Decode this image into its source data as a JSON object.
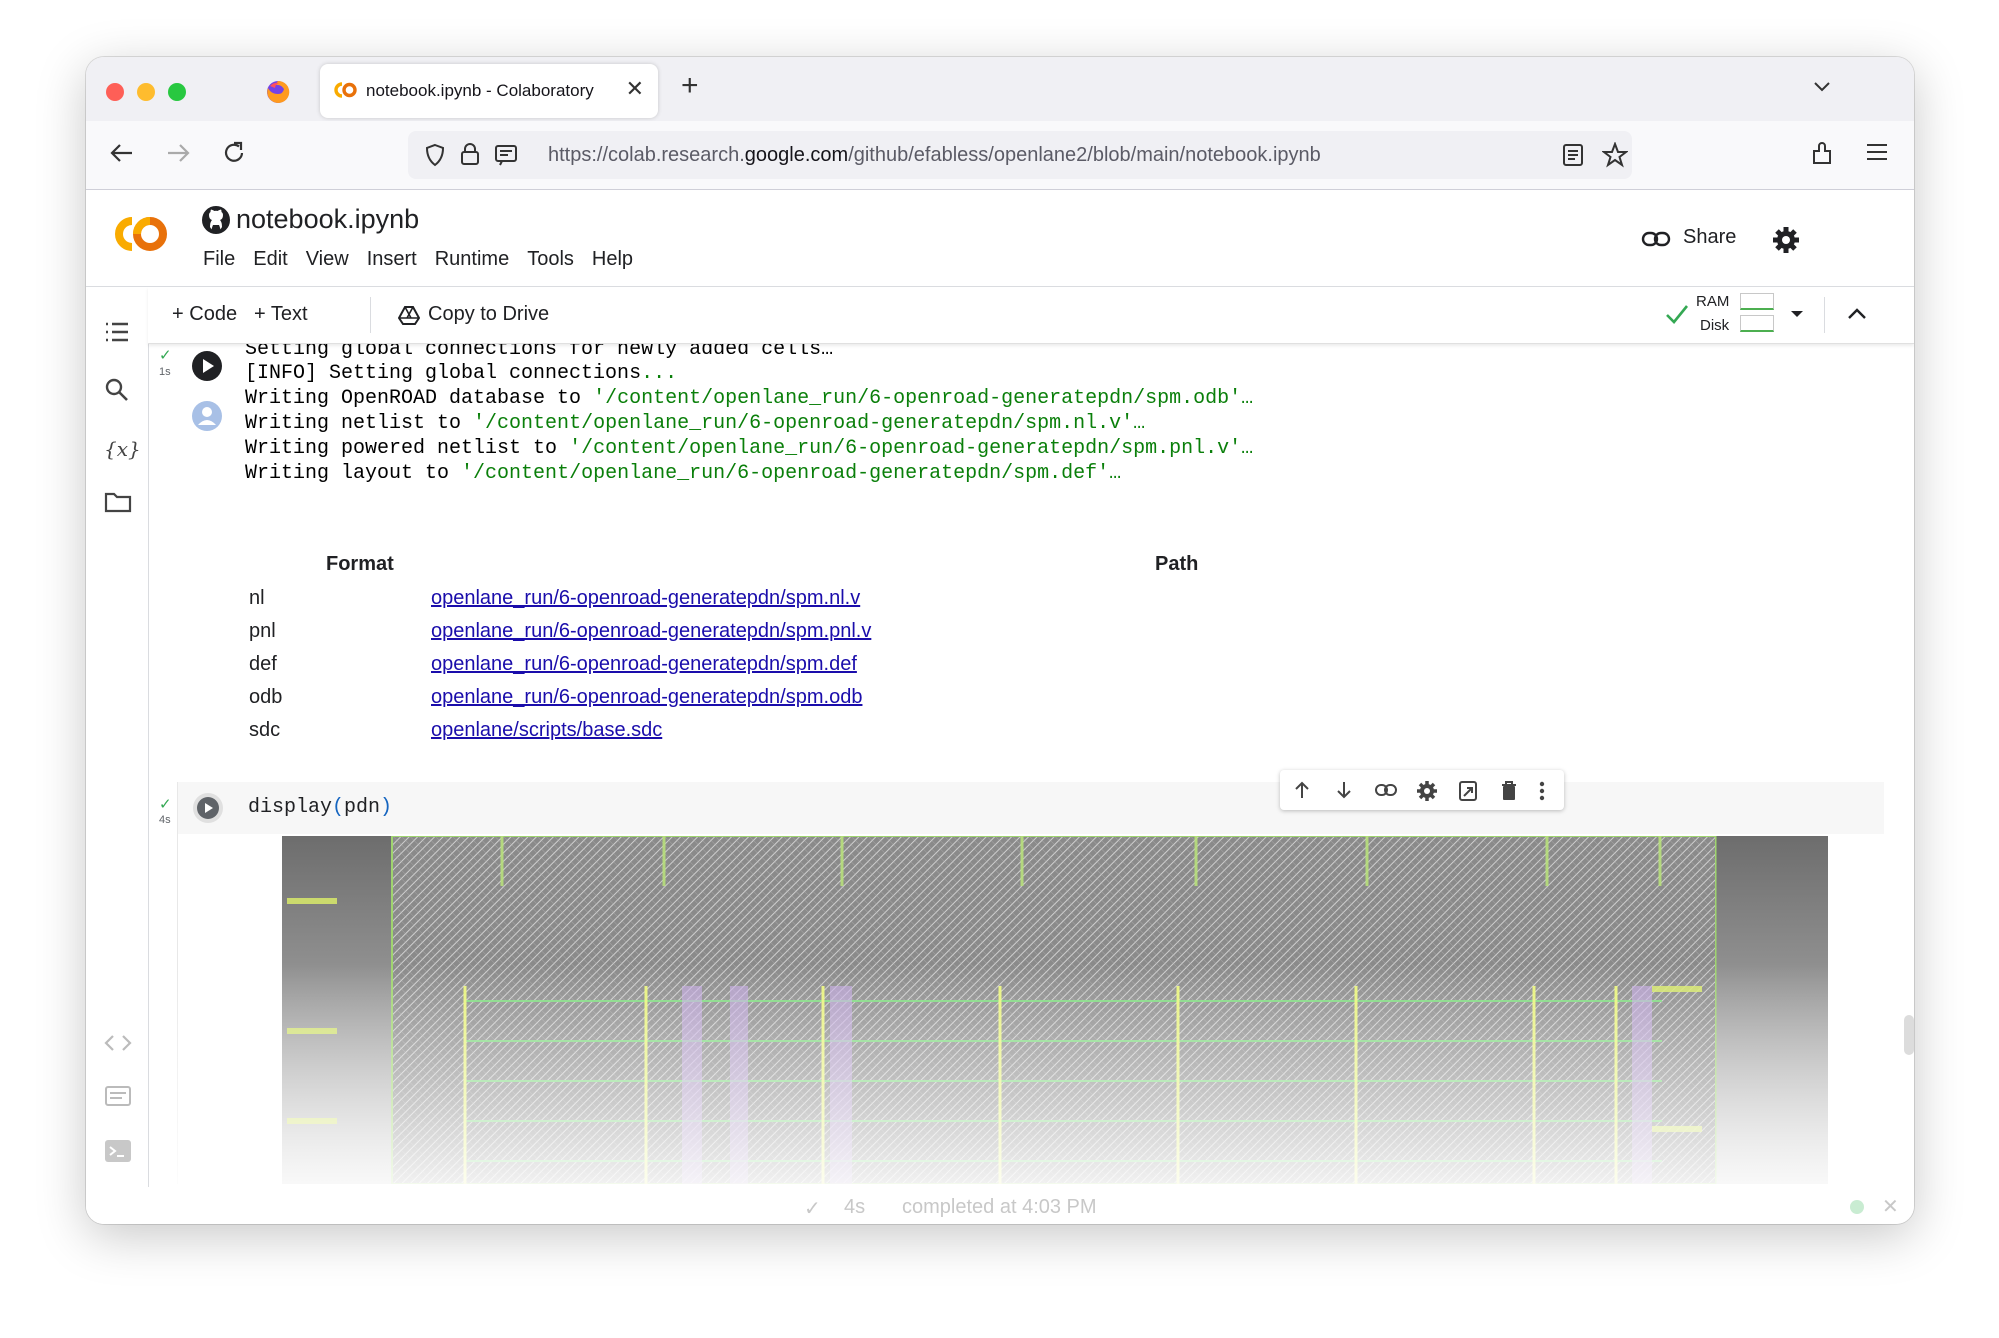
{
  "browser": {
    "tab_title": "notebook.ipynb - Colaboratory",
    "url_prefix": "https://colab.research.",
    "url_domain": "google.com",
    "url_path": "/github/efabless/openlane2/blob/main/notebook.ipynb"
  },
  "header": {
    "notebook_title": "notebook.ipynb",
    "menu": [
      "File",
      "Edit",
      "View",
      "Insert",
      "Runtime",
      "Tools",
      "Help"
    ],
    "share_label": "Share"
  },
  "toolbar": {
    "code_label": "Code",
    "text_label": "Text",
    "copy_label": "Copy to Drive",
    "ram_label": "RAM",
    "disk_label": "Disk"
  },
  "cell1": {
    "time": "1s",
    "output_lines": [
      {
        "plain": "Setting global connections for newly added cells…",
        "green": ""
      },
      {
        "plain": "[INFO] Setting global connections",
        "green": "..."
      },
      {
        "plain": "Writing OpenROAD database to ",
        "green": "'/content/openlane_run/6-openroad-generatepdn/spm.odb'…"
      },
      {
        "plain": "Writing netlist to ",
        "green": "'/content/openlane_run/6-openroad-generatepdn/spm.nl.v'…"
      },
      {
        "plain": "Writing powered netlist to ",
        "green": "'/content/openlane_run/6-openroad-generatepdn/spm.pnl.v'…"
      },
      {
        "plain": "Writing layout to ",
        "green": "'/content/openlane_run/6-openroad-generatepdn/spm.def'…"
      }
    ],
    "table": {
      "headers": [
        "Format",
        "Path"
      ],
      "rows": [
        {
          "format": "nl",
          "path": "openlane_run/6-openroad-generatepdn/spm.nl.v"
        },
        {
          "format": "pnl",
          "path": "openlane_run/6-openroad-generatepdn/spm.pnl.v"
        },
        {
          "format": "def",
          "path": "openlane_run/6-openroad-generatepdn/spm.def"
        },
        {
          "format": "odb",
          "path": "openlane_run/6-openroad-generatepdn/spm.odb"
        },
        {
          "format": "sdc",
          "path": "openlane/scripts/base.sdc"
        }
      ]
    }
  },
  "cell2": {
    "time": "4s",
    "code_fn": "display",
    "code_open": "(",
    "code_arg": "pdn",
    "code_close": ")"
  },
  "status": {
    "time": "4s",
    "text": "completed at 4:03 PM"
  },
  "colors": {
    "accent_green": "#0a7f0a",
    "link": "#1a0dab",
    "colab_orange": "#f9ab00"
  }
}
